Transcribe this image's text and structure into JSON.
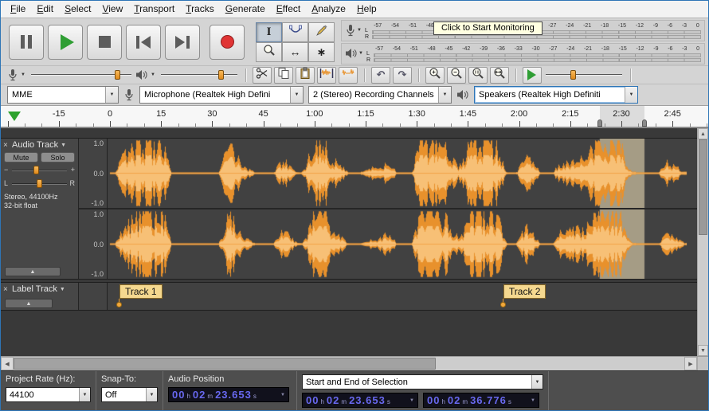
{
  "menu": {
    "items": [
      "File",
      "Edit",
      "Select",
      "View",
      "Transport",
      "Tracks",
      "Generate",
      "Effect",
      "Analyze",
      "Help"
    ]
  },
  "icons": {
    "dropdown_caret": "▼",
    "collapse_caret": "▲",
    "close": "×",
    "selection_tool": "I",
    "time_shift": "↔",
    "multi_tool": "∗",
    "undo": "↶",
    "redo": "↷",
    "scroll_up": "▲",
    "scroll_down": "▼",
    "scroll_left": "◀",
    "scroll_right": "▶"
  },
  "meters": {
    "record_tooltip": "Click to Start Monitoring",
    "channel_labels": [
      "L",
      "R"
    ],
    "scale": [
      "-57",
      "-54",
      "-51",
      "-48",
      "-45",
      "-42",
      "-39",
      "-36",
      "-33",
      "-30",
      "-27",
      "-24",
      "-21",
      "-18",
      "-15",
      "-12",
      "-9",
      "-6",
      "-3",
      "0"
    ]
  },
  "devices": {
    "host": "MME",
    "recording_device": "Microphone (Realtek High Defini",
    "recording_channels": "2 (Stereo) Recording Channels",
    "playback_device": "Speakers (Realtek High Definiti"
  },
  "timeline": {
    "labels": [
      {
        "t": -15,
        "text": "-15"
      },
      {
        "t": 0,
        "text": "0"
      },
      {
        "t": 15,
        "text": "15"
      },
      {
        "t": 30,
        "text": "30"
      },
      {
        "t": 45,
        "text": "45"
      },
      {
        "t": 60,
        "text": "1:00"
      },
      {
        "t": 75,
        "text": "1:15"
      },
      {
        "t": 90,
        "text": "1:30"
      },
      {
        "t": 105,
        "text": "1:45"
      },
      {
        "t": 120,
        "text": "2:00"
      },
      {
        "t": 135,
        "text": "2:15"
      },
      {
        "t": 150,
        "text": "2:30"
      },
      {
        "t": 165,
        "text": "2:45"
      }
    ]
  },
  "selection": {
    "start_s": 143.653,
    "end_s": 156.776
  },
  "audio_track": {
    "name": "Audio Track",
    "mute": "Mute",
    "solo": "Solo",
    "gain_min": "−",
    "gain_max": "+",
    "pan_left": "L",
    "pan_right": "R",
    "info_line1": "Stereo, 44100Hz",
    "info_line2": "32-bit float",
    "vruler": [
      "1.0",
      "0.0",
      "-1.0"
    ]
  },
  "label_track": {
    "name": "Label Track",
    "labels": [
      {
        "t": 2.8,
        "text": "Track 1"
      },
      {
        "t": 115.4,
        "text": "Track 2"
      }
    ]
  },
  "status_bar": {
    "project_rate_label": "Project Rate (Hz):",
    "project_rate_value": "44100",
    "snap_label": "Snap-To:",
    "snap_value": "Off",
    "audio_position_label": "Audio Position",
    "selection_mode": "Start and End of Selection",
    "units": {
      "h": "h",
      "m": "m",
      "s": "s"
    },
    "audio_position": {
      "h": "00",
      "m": "02",
      "s": "23.653"
    },
    "selection_start": {
      "h": "00",
      "m": "02",
      "s": "23.653"
    },
    "selection_end": {
      "h": "00",
      "m": "02",
      "s": "36.776"
    }
  }
}
